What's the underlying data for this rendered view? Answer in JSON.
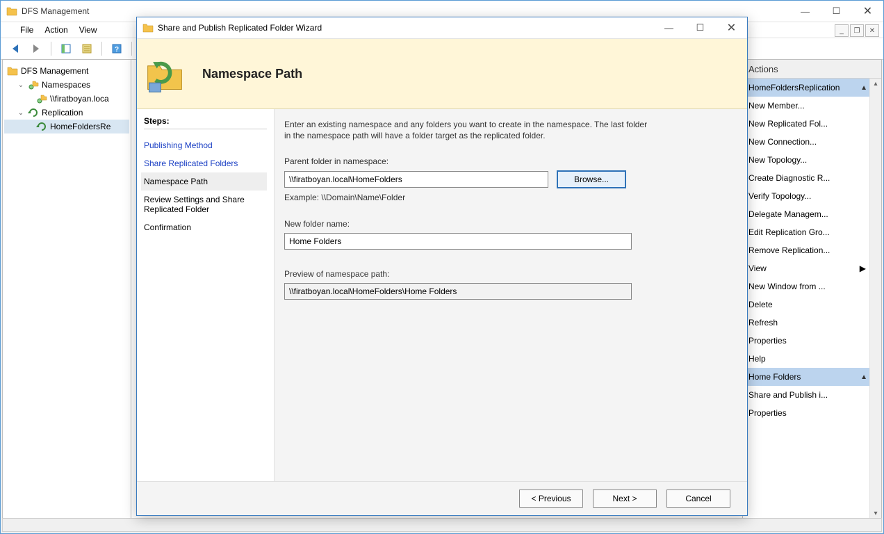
{
  "main": {
    "title": "DFS Management",
    "menu": [
      "File",
      "Action",
      "View"
    ],
    "tree": {
      "root": "DFS Management",
      "namespaces": "Namespaces",
      "ns_item": "\\\\firatboyan.loca",
      "replication": "Replication",
      "rep_item": "HomeFoldersRe"
    },
    "actions_header": "Actions",
    "actions_heading1": "HomeFoldersReplication",
    "actions": [
      "New Member...",
      "New Replicated Fol...",
      "New Connection...",
      "New Topology...",
      "Create Diagnostic R...",
      "Verify Topology...",
      "Delegate Managem...",
      "Edit Replication Gro...",
      "Remove Replication...",
      "View",
      "New Window from ...",
      "Delete",
      "Refresh",
      "Properties",
      "Help"
    ],
    "actions_heading2": "Home Folders",
    "actions2": [
      "Share and Publish i...",
      "Properties"
    ]
  },
  "wizard": {
    "title": "Share and Publish Replicated Folder Wizard",
    "banner_title": "Namespace Path",
    "steps_heading": "Steps:",
    "steps": {
      "publishing": "Publishing Method",
      "share": "Share Replicated Folders",
      "nspath": "Namespace Path",
      "review": "Review Settings and Share Replicated Folder",
      "confirm": "Confirmation"
    },
    "intro": "Enter an existing namespace and any folders you want to create in the namespace. The last folder in the namespace path will have a folder target as the replicated folder.",
    "parent_label": "Parent folder in namespace:",
    "parent_value": "\\\\firatboyan.local\\HomeFolders",
    "browse": "Browse...",
    "example": "Example: \\\\Domain\\Name\\Folder",
    "newfolder_label": "New folder name:",
    "newfolder_value": "Home Folders",
    "preview_label": "Preview of namespace path:",
    "preview_value": "\\\\firatboyan.local\\HomeFolders\\Home Folders",
    "btn_prev": "< Previous",
    "btn_next": "Next >",
    "btn_cancel": "Cancel"
  }
}
